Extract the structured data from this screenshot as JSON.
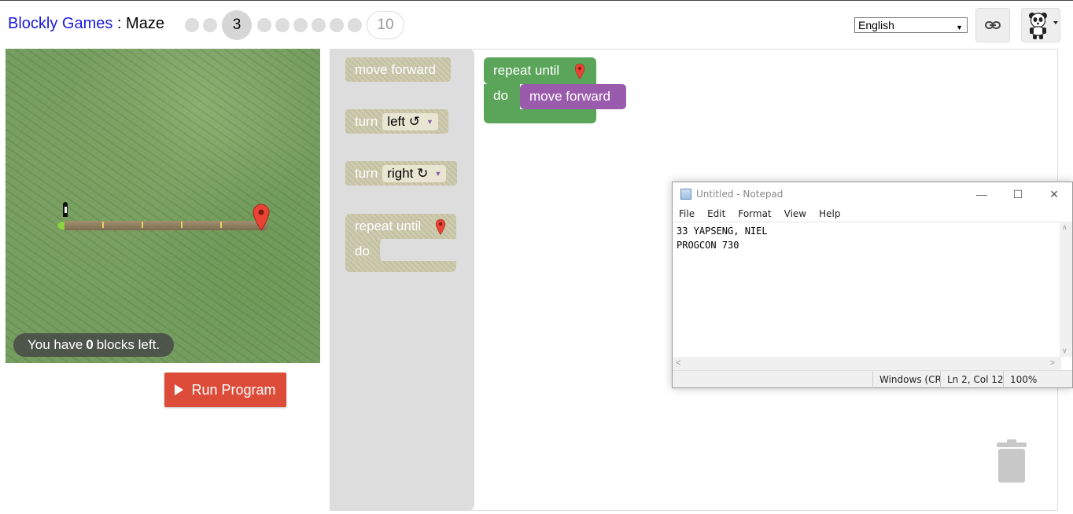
{
  "header": {
    "app_name": "Blockly Games",
    "separator": " : ",
    "game_name": "Maze",
    "current_level": "3",
    "last_level": "10",
    "language": "English"
  },
  "maze": {
    "blocks_left_prefix": "You have",
    "blocks_left_count": "0",
    "blocks_left_suffix": "blocks left."
  },
  "run_button": {
    "label": "Run Program"
  },
  "toolbox": {
    "move_forward": "move forward",
    "turn_left_label": "turn",
    "turn_left_value": "left ↺",
    "turn_right_label": "turn",
    "turn_right_value": "right ↻",
    "repeat_label": "repeat until",
    "repeat_do": "do"
  },
  "workspace": {
    "repeat_label": "repeat until",
    "repeat_do": "do",
    "inner_block": "move forward"
  },
  "notepad": {
    "title": "Untitled - Notepad",
    "menu": [
      "File",
      "Edit",
      "Format",
      "View",
      "Help"
    ],
    "content": "33 YAPSENG, NIEL\nPROGCON 730",
    "status_encoding": "Windows (CR",
    "status_position": "Ln 2, Col 12",
    "status_zoom": "100%"
  },
  "colors": {
    "logic_green": "#5ba55b",
    "movement_purple": "#9a5bac",
    "run_red": "#dd4b39",
    "title_blue": "#1a1adb"
  }
}
